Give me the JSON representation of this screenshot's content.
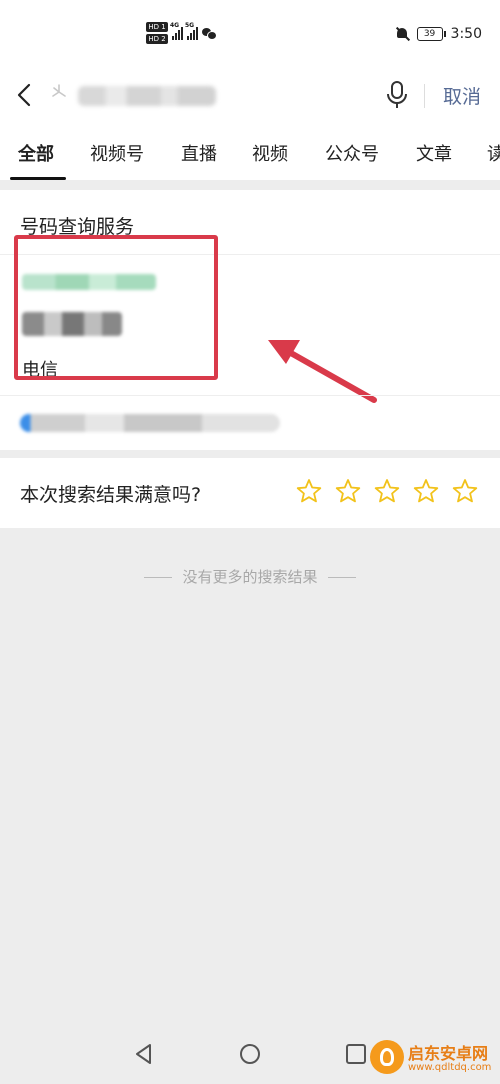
{
  "status_bar": {
    "hd1": "HD 1",
    "hd2": "HD 2",
    "net1": "4G",
    "net2": "5G",
    "battery": "39",
    "time": "3:50"
  },
  "search": {
    "query": "",
    "cancel_label": "取消"
  },
  "tabs": [
    {
      "label": "全部",
      "active": true
    },
    {
      "label": "视频号"
    },
    {
      "label": "直播"
    },
    {
      "label": "视频"
    },
    {
      "label": "公众号"
    },
    {
      "label": "文章"
    },
    {
      "label": "读"
    }
  ],
  "result_card": {
    "title": "号码查询服务",
    "carrier": "电信"
  },
  "feedback": {
    "question": "本次搜索结果满意吗?",
    "stars": 5
  },
  "footer_text": "没有更多的搜索结果",
  "watermark": {
    "title": "启东安卓网",
    "url": "www.qdltdq.com"
  },
  "colors": {
    "highlight": "#d93a4a",
    "link": "#576b95",
    "star": "#f2c21a",
    "watermark": "#e77e16"
  }
}
